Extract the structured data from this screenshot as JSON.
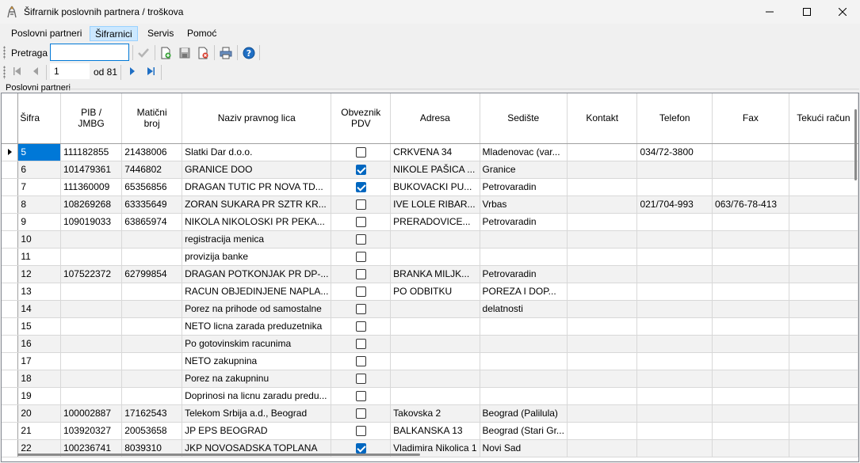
{
  "window": {
    "title": "Šifrarnik poslovnih partnera / troškova"
  },
  "menu": [
    "Poslovni partneri",
    "Šifrarnici",
    "Servis",
    "Pomoć"
  ],
  "menu_active": "Šifrarnici",
  "toolbar": {
    "search_label": "Pretraga",
    "search_value": ""
  },
  "navigator": {
    "position": "1",
    "of_label": "od 81"
  },
  "section_label": "Poslovni partneri",
  "grid": {
    "columns": [
      "Šifra",
      "PIB /\nJMBG",
      "Matični\nbroj",
      "Naziv pravnog lica",
      "Obveznik\nPDV",
      "Adresa",
      "Sedište",
      "Kontakt",
      "Telefon",
      "Fax",
      "Tekući račun"
    ],
    "rows": [
      {
        "sifra": "5",
        "pib": "111182855",
        "mb": "21438006",
        "naziv": "Slatki Dar d.o.o.",
        "pdv": false,
        "adresa": "CRKVENA 34",
        "sediste": "Mladenovac (var...",
        "kontakt": "",
        "telefon": "034/72-3800",
        "fax": "",
        "racun": ""
      },
      {
        "sifra": "6",
        "pib": "101479361",
        "mb": "7446802",
        "naziv": "GRANICE DOO",
        "pdv": true,
        "adresa": "NIKOLE PAŠICA ...",
        "sediste": "Granice",
        "kontakt": "",
        "telefon": "",
        "fax": "",
        "racun": ""
      },
      {
        "sifra": "7",
        "pib": "111360009",
        "mb": "65356856",
        "naziv": "DRAGAN TUTIC PR NOVA TD...",
        "pdv": true,
        "adresa": "BUKOVACKI PU...",
        "sediste": "Petrovaradin",
        "kontakt": "",
        "telefon": "",
        "fax": "",
        "racun": ""
      },
      {
        "sifra": "8",
        "pib": "108269268",
        "mb": "63335649",
        "naziv": "ZORAN SUKARA PR SZTR KR...",
        "pdv": false,
        "adresa": "IVE LOLE RIBAR...",
        "sediste": "Vrbas",
        "kontakt": "",
        "telefon": "021/704-993",
        "fax": "063/76-78-413",
        "racun": ""
      },
      {
        "sifra": "9",
        "pib": "109019033",
        "mb": "63865974",
        "naziv": "NIKOLA NIKOLOSKI PR PEKA...",
        "pdv": false,
        "adresa": "PRERADOVICE...",
        "sediste": "Petrovaradin",
        "kontakt": "",
        "telefon": "",
        "fax": "",
        "racun": ""
      },
      {
        "sifra": "10",
        "pib": "",
        "mb": "",
        "naziv": "registracija menica",
        "pdv": false,
        "adresa": "",
        "sediste": "",
        "kontakt": "",
        "telefon": "",
        "fax": "",
        "racun": ""
      },
      {
        "sifra": "11",
        "pib": "",
        "mb": "",
        "naziv": "provizija banke",
        "pdv": false,
        "adresa": "",
        "sediste": "",
        "kontakt": "",
        "telefon": "",
        "fax": "",
        "racun": ""
      },
      {
        "sifra": "12",
        "pib": "107522372",
        "mb": "62799854",
        "naziv": "DRAGAN POTKONJAK PR DP-...",
        "pdv": false,
        "adresa": "BRANKA MILJK...",
        "sediste": "Petrovaradin",
        "kontakt": "",
        "telefon": "",
        "fax": "",
        "racun": ""
      },
      {
        "sifra": "13",
        "pib": "",
        "mb": "",
        "naziv": "RACUN OBJEDINJENE NAPLA...",
        "pdv": false,
        "adresa": "PO ODBITKU",
        "sediste": "POREZA I DOP...",
        "kontakt": "",
        "telefon": "",
        "fax": "",
        "racun": ""
      },
      {
        "sifra": "14",
        "pib": "",
        "mb": "",
        "naziv": "Porez na prihode od samostalne",
        "pdv": false,
        "adresa": "",
        "sediste": "delatnosti",
        "kontakt": "",
        "telefon": "",
        "fax": "",
        "racun": ""
      },
      {
        "sifra": "15",
        "pib": "",
        "mb": "",
        "naziv": "NETO licna zarada preduzetnika",
        "pdv": false,
        "adresa": "",
        "sediste": "",
        "kontakt": "",
        "telefon": "",
        "fax": "",
        "racun": ""
      },
      {
        "sifra": "16",
        "pib": "",
        "mb": "",
        "naziv": "Po gotovinskim racunima",
        "pdv": false,
        "adresa": "",
        "sediste": "",
        "kontakt": "",
        "telefon": "",
        "fax": "",
        "racun": ""
      },
      {
        "sifra": "17",
        "pib": "",
        "mb": "",
        "naziv": "NETO zakupnina",
        "pdv": false,
        "adresa": "",
        "sediste": "",
        "kontakt": "",
        "telefon": "",
        "fax": "",
        "racun": ""
      },
      {
        "sifra": "18",
        "pib": "",
        "mb": "",
        "naziv": "Porez na zakupninu",
        "pdv": false,
        "adresa": "",
        "sediste": "",
        "kontakt": "",
        "telefon": "",
        "fax": "",
        "racun": ""
      },
      {
        "sifra": "19",
        "pib": "",
        "mb": "",
        "naziv": "Doprinosi na licnu zaradu predu...",
        "pdv": false,
        "adresa": "",
        "sediste": "",
        "kontakt": "",
        "telefon": "",
        "fax": "",
        "racun": ""
      },
      {
        "sifra": "20",
        "pib": "100002887",
        "mb": "17162543",
        "naziv": "Telekom Srbija a.d., Beograd",
        "pdv": false,
        "adresa": "Takovska 2",
        "sediste": "Beograd (Palilula)",
        "kontakt": "",
        "telefon": "",
        "fax": "",
        "racun": ""
      },
      {
        "sifra": "21",
        "pib": "103920327",
        "mb": "20053658",
        "naziv": "JP EPS BEOGRAD",
        "pdv": false,
        "adresa": "BALKANSKA 13",
        "sediste": "Beograd (Stari Gr...",
        "kontakt": "",
        "telefon": "",
        "fax": "",
        "racun": ""
      },
      {
        "sifra": "22",
        "pib": "100236741",
        "mb": "8039310",
        "naziv": "JKP NOVOSADSKA TOPLANA",
        "pdv": true,
        "adresa": "Vladimira Nikolica 1",
        "sediste": "Novi Sad",
        "kontakt": "",
        "telefon": "",
        "fax": "",
        "racun": ""
      }
    ]
  }
}
